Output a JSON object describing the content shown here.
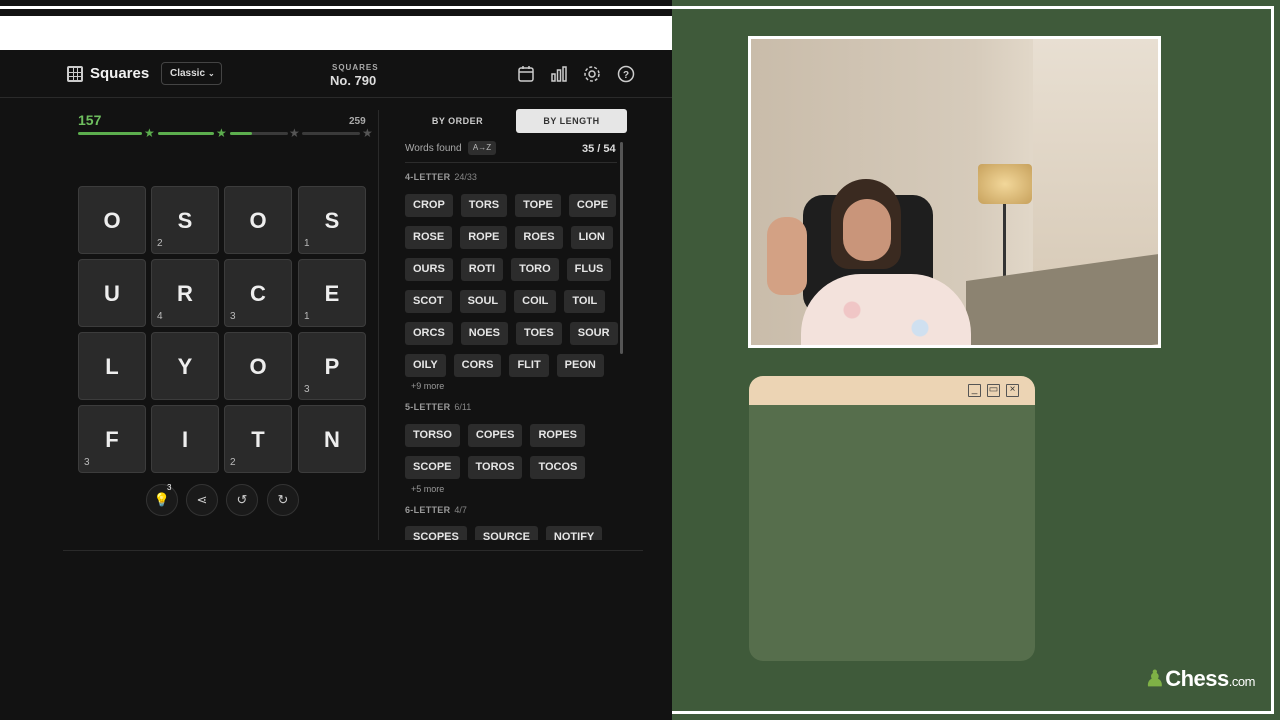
{
  "header": {
    "app_title": "Squares",
    "mode": "Classic",
    "puzzle_label": "SQUARES",
    "puzzle_number": "No. 790",
    "icons": [
      "calendar-icon",
      "stats-icon",
      "settings-icon",
      "help-icon"
    ]
  },
  "progress": {
    "score": "157",
    "max": "259",
    "fraction": 0.61
  },
  "grid": [
    {
      "letter": "O",
      "num": ""
    },
    {
      "letter": "S",
      "num": "2"
    },
    {
      "letter": "O",
      "num": ""
    },
    {
      "letter": "S",
      "num": "1"
    },
    {
      "letter": "U",
      "num": ""
    },
    {
      "letter": "R",
      "num": "4"
    },
    {
      "letter": "C",
      "num": "3"
    },
    {
      "letter": "E",
      "num": "1"
    },
    {
      "letter": "L",
      "num": ""
    },
    {
      "letter": "Y",
      "num": ""
    },
    {
      "letter": "O",
      "num": ""
    },
    {
      "letter": "P",
      "num": "3"
    },
    {
      "letter": "F",
      "num": "3"
    },
    {
      "letter": "I",
      "num": ""
    },
    {
      "letter": "T",
      "num": "2"
    },
    {
      "letter": "N",
      "num": ""
    }
  ],
  "tools": {
    "hint_count": "3"
  },
  "panel": {
    "tab_order": "BY ORDER",
    "tab_length": "BY LENGTH",
    "words_found_label": "Words found",
    "sort_label": "A→Z",
    "found_count": "35 / 54",
    "sections": [
      {
        "title": "4-LETTER",
        "count": "24/33",
        "rows": [
          [
            "CROP",
            "TORS",
            "TOPE",
            "COPE"
          ],
          [
            "ROSE",
            "ROPE",
            "ROES",
            "LION"
          ],
          [
            "OURS",
            "ROTI",
            "TORO",
            "FLUS"
          ],
          [
            "SCOT",
            "SOUL",
            "COIL",
            "TOIL"
          ],
          [
            "ORCS",
            "NOES",
            "TOES",
            "SOUR"
          ],
          [
            "OILY",
            "CORS",
            "FLIT",
            "PEON"
          ]
        ],
        "more": "+9 more"
      },
      {
        "title": "5-LETTER",
        "count": "6/11",
        "rows": [
          [
            "TORSO",
            "COPES",
            "ROPES"
          ],
          [
            "SCOPE",
            "TOROS",
            "TOCOS"
          ]
        ],
        "more": "+5 more"
      },
      {
        "title": "6-LETTER",
        "count": "4/7",
        "rows": [
          [
            "SCOPES",
            "SOURCE",
            "NOTIFY"
          ]
        ],
        "more": ""
      }
    ]
  },
  "brand": {
    "name": "Chess",
    "suffix": ".com"
  },
  "colors": {
    "accent_green": "#6fbf5f",
    "background_green": "#3f5a3a",
    "panel_dark": "#121212"
  }
}
